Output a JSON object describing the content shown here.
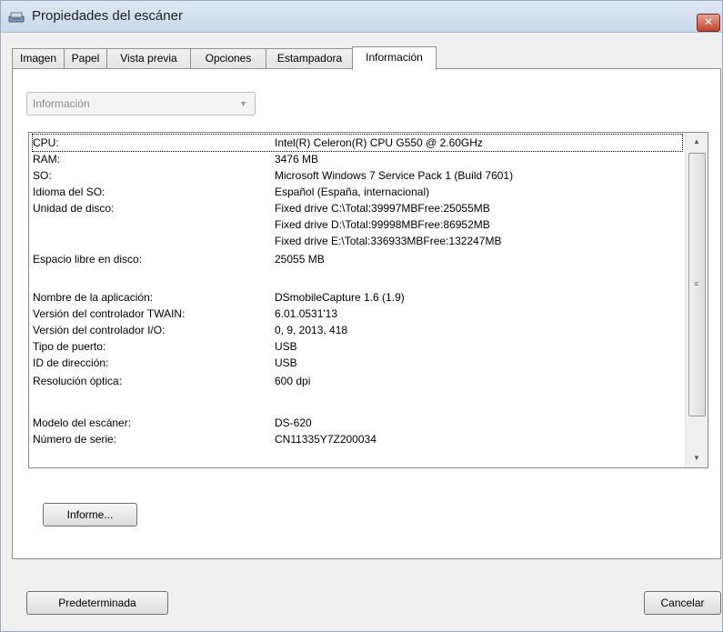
{
  "window": {
    "title": "Propiedades del escáner"
  },
  "tabs": [
    {
      "label": "Imagen"
    },
    {
      "label": "Papel"
    },
    {
      "label": "Vista previa"
    },
    {
      "label": "Opciones"
    },
    {
      "label": "Estampadora"
    },
    {
      "label": "Información"
    }
  ],
  "active_tab": "Información",
  "combo": {
    "value": "Información"
  },
  "info_rows": [
    {
      "label": "CPU:",
      "value": "Intel(R) Celeron(R) CPU G550 @ 2.60GHz"
    },
    {
      "label": "RAM:",
      "value": "3476 MB"
    },
    {
      "label": "SO:",
      "value": "Microsoft Windows 7 Service Pack 1 (Build 7601)"
    },
    {
      "label": "Idioma del SO:",
      "value": "Español (España, internacional)"
    },
    {
      "label": "Unidad de disco:",
      "value": "Fixed drive C:\\Total:39997MBFree:25055MB"
    },
    {
      "label": "",
      "value": "Fixed drive D:\\Total:99998MBFree:86952MB"
    },
    {
      "label": "",
      "value": "Fixed drive E:\\Total:336933MBFree:132247MB"
    },
    {
      "label": "Espacio libre en disco:",
      "value": "25055 MB"
    },
    {
      "label": "Nombre de la aplicación:",
      "value": " DSmobileCapture 1.6 (1.9)"
    },
    {
      "label": "Versión del controlador TWAIN:",
      "value": "6.01.0531'13"
    },
    {
      "label": "Versión del controlador I/O:",
      "value": "0, 9, 2013, 418"
    },
    {
      "label": "Tipo de puerto:",
      "value": "USB"
    },
    {
      "label": "ID de dirección:",
      "value": "USB"
    },
    {
      "label": "Resolución óptica:",
      "value": "600 dpi"
    },
    {
      "label": "Modelo del escáner:",
      "value": "DS-620"
    },
    {
      "label": "Número de serie:",
      "value": "CN11335Y7Z200034"
    }
  ],
  "buttons": {
    "report": "Informe...",
    "default": "Predeterminada",
    "cancel": "Cancelar"
  },
  "icons": {
    "title": "scanner-icon",
    "close": "close-icon"
  }
}
